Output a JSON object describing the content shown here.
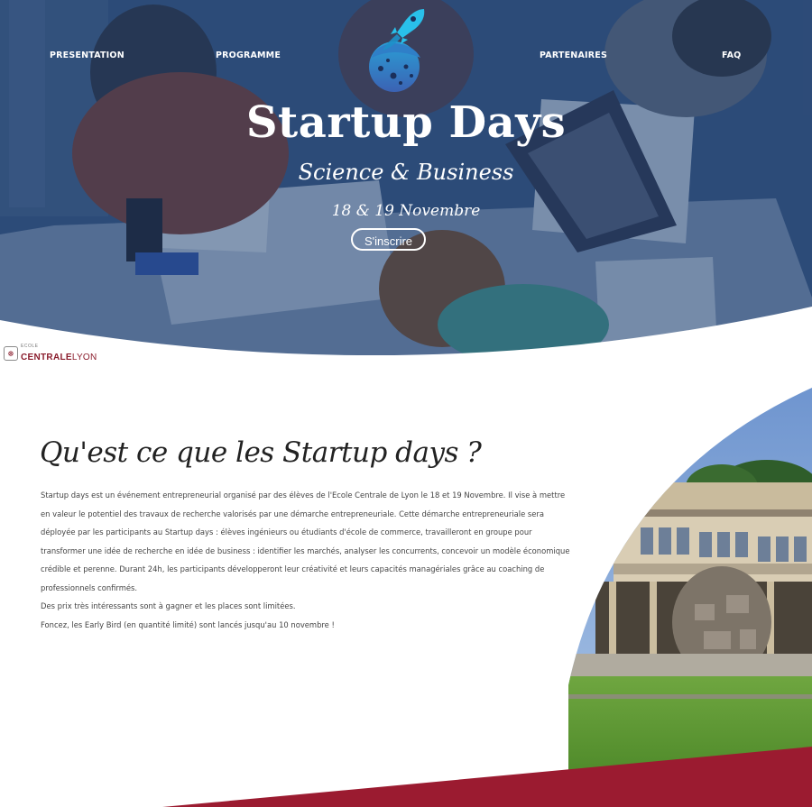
{
  "nav": {
    "items": [
      {
        "id": "presentation",
        "label": "PRESENTATION"
      },
      {
        "id": "programme",
        "label": "PROGRAMME"
      },
      {
        "id": "partenaires",
        "label": "PARTENAIRES"
      },
      {
        "id": "faq",
        "label": "FAQ"
      }
    ]
  },
  "hero": {
    "title": "Startup Days",
    "subtitle": "Science & Business",
    "dates": "18 & 19 Novembre",
    "cta_label": "S'inscrire",
    "logo_icon": "rocket-icon"
  },
  "school": {
    "small_text": "ECOLE",
    "name_part1": "CENTRALE",
    "name_part2": "LYON"
  },
  "about": {
    "title": "Qu'est ce que les Startup days ?",
    "paragraphs": [
      "Startup days est un événement entrepreneurial organisé par des élèves de l'Ecole Centrale de Lyon le 18 et 19 Novembre. Il vise à mettre en valeur le potentiel des travaux de recherche valorisés par une démarche entrepreneuriale. Cette démarche entrepreneuriale sera déployée par les participants au Startup days : élèves ingénieurs ou étudiants d'école de commerce, travailleront en groupe pour transformer une idée de recherche en idée de business : identifier les marchés, analyser les concurrents, concevoir un modèle économique crédible et perenne. Durant 24h, les participants développeront leur créativité et leurs capacités managériales grâce au coaching de professionnels confirmés.",
      "Des prix très intéressants sont à gagner et les places sont limitées.",
      "Foncez, les Early Bird (en quantité limité) sont lancés jusqu'au 10 novembre !"
    ]
  },
  "colors": {
    "hero_blue": "#2c4a76",
    "accent_red": "#9b1b30",
    "rocket_cyan": "#29b6e6"
  }
}
